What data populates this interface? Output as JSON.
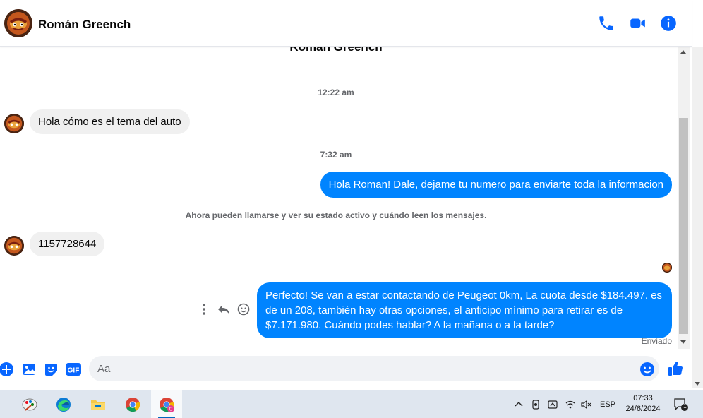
{
  "header": {
    "contact_name": "Román Greench",
    "actions": [
      "phone-icon",
      "video-call-icon",
      "info-icon"
    ]
  },
  "conversation": {
    "top_name": "Román Greench",
    "timestamps": [
      "12:22 am",
      "7:32 am"
    ],
    "messages": [
      {
        "direction": "incoming",
        "text": "Hola cómo es el tema del auto"
      },
      {
        "direction": "outgoing",
        "text": "Hola Roman! Dale, dejame tu numero para enviarte toda la informacion"
      },
      {
        "direction": "incoming",
        "text": "1157728644"
      },
      {
        "direction": "outgoing",
        "text": "Perfecto!  Se van a estar contactando de Peugeot 0km, La cuota desde $184.497. es de un 208, también hay otras opciones, el anticipo mínimo para retirar es de $7.171.980. Cuándo podes hablar? A la mañana o a la tarde?"
      }
    ],
    "system_note": "Ahora pueden llamarse y ver su estado activo y cuándo leen los mensajes.",
    "status": "Enviado",
    "message_actions": [
      "more-icon",
      "reply-icon",
      "emoji-react-icon"
    ]
  },
  "composer": {
    "placeholder": "Aa",
    "buttons": [
      "plus-icon",
      "image-icon",
      "sticker-icon",
      "gif-icon"
    ],
    "gif_label": "GIF",
    "like": "like-icon",
    "emoji": "emoji-icon"
  },
  "taskbar": {
    "apps": [
      "paint-icon",
      "edge-icon",
      "file-explorer-icon",
      "chrome-icon",
      "chrome-profile-icon"
    ],
    "tray": [
      "chevron-up-icon",
      "meet-now-icon",
      "onedrive-icon",
      "wifi-icon",
      "speaker-muted-icon"
    ],
    "language": "ESP",
    "time": "07:33",
    "date": "24/6/2024",
    "notification_count": "1"
  },
  "colors": {
    "messenger_blue": "#0084ff",
    "incoming_bubble": "#f0f0f0",
    "accent": "#0866ff",
    "taskbar": "#dfe6ef"
  }
}
